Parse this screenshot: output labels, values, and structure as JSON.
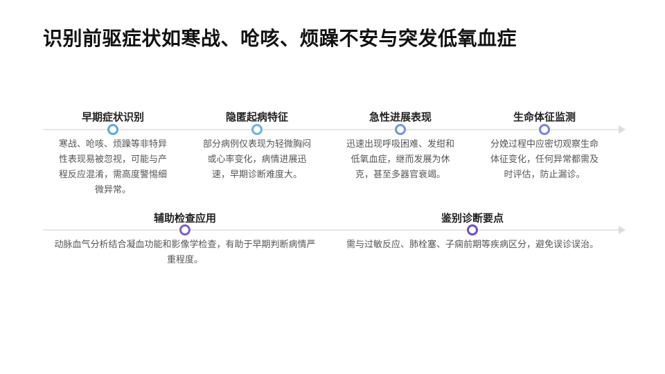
{
  "page": {
    "title": "识别前驱症状如寒战、呛咳、烦躁不安与突发低氧血症"
  },
  "timeline_row1": {
    "items": [
      {
        "label": "早期症状识别",
        "text": "寒战、呛咳、烦躁等非特异性表现易被忽视，可能与产程反应混淆，需高度警惕细微异常。",
        "color": "#5aa9e0"
      },
      {
        "label": "隐匿起病特征",
        "text": "部分病例仅表现为轻微胸闷或心率变化，病情进展迅速，早期诊断难度大。",
        "color": "#6cb4d8"
      },
      {
        "label": "急性进展表现",
        "text": "迅速出现呼吸困难、发绀和低氧血症，继而发展为休克，甚至多器官衰竭。",
        "color": "#6f95df"
      },
      {
        "label": "生命体征监测",
        "text": "分娩过程中应密切观察生命体征变化，任何异常都需及时评估，防止漏诊。",
        "color": "#7d7fe0"
      }
    ]
  },
  "timeline_row2": {
    "items": [
      {
        "label": "辅助检查应用",
        "text": "动脉血气分析结合凝血功能和影像学检查，有助于早期判断病情严重程度。",
        "color": "#7660cc"
      },
      {
        "label": "鉴别诊断要点",
        "text": "需与过敏反应、肺栓塞、子痫前期等疾病区分，避免误诊误治。",
        "color": "#6c4fc4"
      }
    ]
  }
}
